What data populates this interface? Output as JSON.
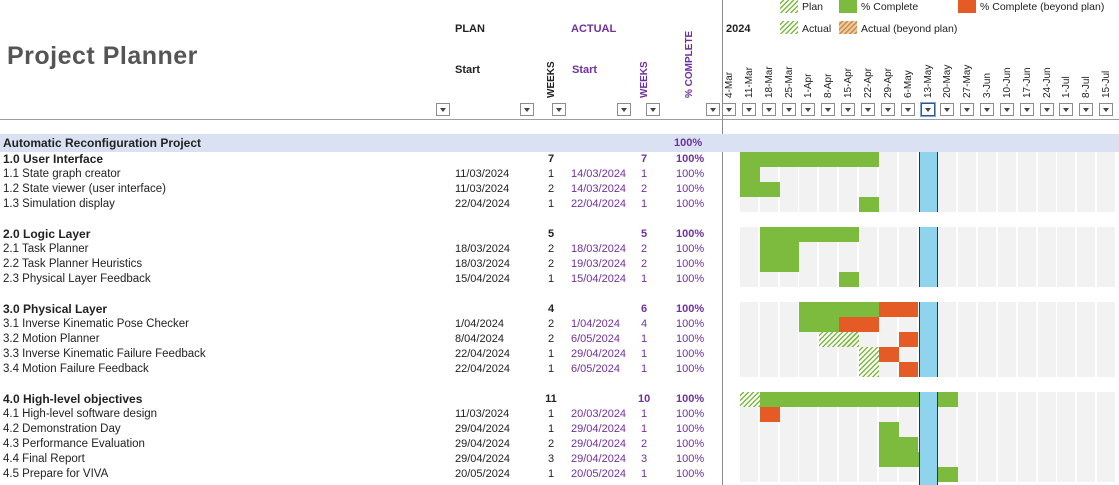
{
  "title": "Project Planner",
  "headers": {
    "plan": "PLAN",
    "actual": "ACTUAL",
    "plan_start": "Start",
    "plan_weeks": "WEEKS",
    "actual_start": "Start",
    "actual_weeks": "WEEKS",
    "complete": "% COMPLETE",
    "year": "2024"
  },
  "legend": {
    "plan": "Plan",
    "complete": "% Complete",
    "complete_beyond": "% Complete (beyond plan)",
    "actual": "Actual",
    "actual_beyond": "Actual (beyond plan)"
  },
  "colors": {
    "complete": "#7cbb3d",
    "beyond": "#e55b25",
    "actual_beyond": "#dba46b",
    "today": "#8fd3ec",
    "project_band": "#d9e1f2",
    "accent": "#7030a0"
  },
  "week_columns": [
    "4-Mar",
    "11-Mar",
    "18-Mar",
    "25-Mar",
    "1-Apr",
    "8-Apr",
    "15-Apr",
    "22-Apr",
    "29-Apr",
    "6-May",
    "13-May",
    "20-May",
    "27-May",
    "3-Jun",
    "10-Jun",
    "17-Jun",
    "24-Jun",
    "1-Jul",
    "8-Jul",
    "15-Jul"
  ],
  "today_week": "13-May",
  "project": {
    "name": "Automatic Reconfiguration Project",
    "complete": "100%"
  },
  "rows": [
    {
      "task": "1.0 User Interface",
      "plan_start": "",
      "plan_weeks": "7",
      "actual_start": "",
      "actual_weeks": "7",
      "complete": "100%",
      "group": true
    },
    {
      "task": "1.1 State graph creator",
      "plan_start": "11/03/2024",
      "plan_weeks": "1",
      "actual_start": "14/03/2024",
      "actual_weeks": "1",
      "complete": "100%"
    },
    {
      "task": "1.2 State viewer (user interface)",
      "plan_start": "11/03/2024",
      "plan_weeks": "2",
      "actual_start": "14/03/2024",
      "actual_weeks": "2",
      "complete": "100%"
    },
    {
      "task": "1.3 Simulation display",
      "plan_start": "22/04/2024",
      "plan_weeks": "1",
      "actual_start": "22/04/2024",
      "actual_weeks": "1",
      "complete": "100%"
    },
    {
      "task": "",
      "plan_start": "",
      "plan_weeks": "",
      "actual_start": "",
      "actual_weeks": "",
      "complete": ""
    },
    {
      "task": "2.0 Logic Layer",
      "plan_start": "",
      "plan_weeks": "5",
      "actual_start": "",
      "actual_weeks": "5",
      "complete": "100%",
      "group": true
    },
    {
      "task": "2.1 Task Planner",
      "plan_start": "18/03/2024",
      "plan_weeks": "2",
      "actual_start": "18/03/2024",
      "actual_weeks": "2",
      "complete": "100%"
    },
    {
      "task": "2.2 Task Planner Heuristics",
      "plan_start": "18/03/2024",
      "plan_weeks": "2",
      "actual_start": "19/03/2024",
      "actual_weeks": "2",
      "complete": "100%"
    },
    {
      "task": "2.3 Physical Layer Feedback",
      "plan_start": "15/04/2024",
      "plan_weeks": "1",
      "actual_start": "15/04/2024",
      "actual_weeks": "1",
      "complete": "100%"
    },
    {
      "task": "",
      "plan_start": "",
      "plan_weeks": "",
      "actual_start": "",
      "actual_weeks": "",
      "complete": ""
    },
    {
      "task": "3.0 Physical Layer",
      "plan_start": "",
      "plan_weeks": "4",
      "actual_start": "",
      "actual_weeks": "6",
      "complete": "100%",
      "group": true
    },
    {
      "task": "3.1 Inverse Kinematic Pose Checker",
      "plan_start": "1/04/2024",
      "plan_weeks": "2",
      "actual_start": "1/04/2024",
      "actual_weeks": "4",
      "complete": "100%"
    },
    {
      "task": "3.2 Motion Planner",
      "plan_start": "8/04/2024",
      "plan_weeks": "2",
      "actual_start": "6/05/2024",
      "actual_weeks": "1",
      "complete": "100%"
    },
    {
      "task": "3.3 Inverse Kinematic Failure Feedback",
      "plan_start": "22/04/2024",
      "plan_weeks": "1",
      "actual_start": "29/04/2024",
      "actual_weeks": "1",
      "complete": "100%"
    },
    {
      "task": "3.4 Motion Failure Feedback",
      "plan_start": "22/04/2024",
      "plan_weeks": "1",
      "actual_start": "6/05/2024",
      "actual_weeks": "1",
      "complete": "100%"
    },
    {
      "task": "",
      "plan_start": "",
      "plan_weeks": "",
      "actual_start": "",
      "actual_weeks": "",
      "complete": ""
    },
    {
      "task": "4.0 High-level objectives",
      "plan_start": "",
      "plan_weeks": "11",
      "actual_start": "",
      "actual_weeks": "10",
      "complete": "100%",
      "group": true
    },
    {
      "task": "4.1 High-level software design",
      "plan_start": "11/03/2024",
      "plan_weeks": "1",
      "actual_start": "20/03/2024",
      "actual_weeks": "1",
      "complete": "100%"
    },
    {
      "task": "4.2 Demonstration Day",
      "plan_start": "29/04/2024",
      "plan_weeks": "1",
      "actual_start": "29/04/2024",
      "actual_weeks": "1",
      "complete": "100%"
    },
    {
      "task": "4.3 Performance Evaluation",
      "plan_start": "29/04/2024",
      "plan_weeks": "2",
      "actual_start": "29/04/2024",
      "actual_weeks": "2",
      "complete": "100%"
    },
    {
      "task": "4.4 Final Report",
      "plan_start": "29/04/2024",
      "plan_weeks": "3",
      "actual_start": "29/04/2024",
      "actual_weeks": "3",
      "complete": "100%"
    },
    {
      "task": "4.5 Prepare for VIVA",
      "plan_start": "20/05/2024",
      "plan_weeks": "1",
      "actual_start": "20/05/2024",
      "actual_weeks": "1",
      "complete": "100%"
    }
  ],
  "gantt": [
    {
      "green": [
        [
          1,
          8
        ]
      ]
    },
    {
      "green": [
        [
          1,
          2
        ]
      ]
    },
    {
      "green": [
        [
          1,
          3
        ]
      ]
    },
    {
      "green": [
        [
          7,
          8
        ]
      ]
    },
    null,
    {
      "green": [
        [
          2,
          7
        ]
      ]
    },
    {
      "green": [
        [
          2,
          4
        ]
      ]
    },
    {
      "green": [
        [
          2,
          4
        ]
      ]
    },
    {
      "green": [
        [
          6,
          7
        ]
      ]
    },
    null,
    {
      "green": [
        [
          4,
          8
        ]
      ],
      "orange": [
        [
          8,
          10
        ]
      ]
    },
    {
      "green": [
        [
          4,
          6
        ]
      ],
      "orange": [
        [
          6,
          8
        ]
      ]
    },
    {
      "hatch": [
        [
          5,
          7
        ]
      ],
      "orange": [
        [
          9,
          10
        ]
      ]
    },
    {
      "hatch": [
        [
          7,
          8
        ]
      ],
      "orange": [
        [
          8,
          9
        ]
      ]
    },
    {
      "hatch": [
        [
          7,
          8
        ]
      ],
      "orange": [
        [
          9,
          10
        ]
      ]
    },
    null,
    {
      "hatch": [
        [
          1,
          2
        ]
      ],
      "green": [
        [
          2,
          12
        ]
      ]
    },
    {
      "orange": [
        [
          2,
          3
        ]
      ]
    },
    {
      "green": [
        [
          8,
          9
        ]
      ]
    },
    {
      "green": [
        [
          8,
          10
        ]
      ]
    },
    {
      "green": [
        [
          8,
          11
        ]
      ]
    },
    {
      "green": [
        [
          11,
          12
        ]
      ]
    }
  ]
}
